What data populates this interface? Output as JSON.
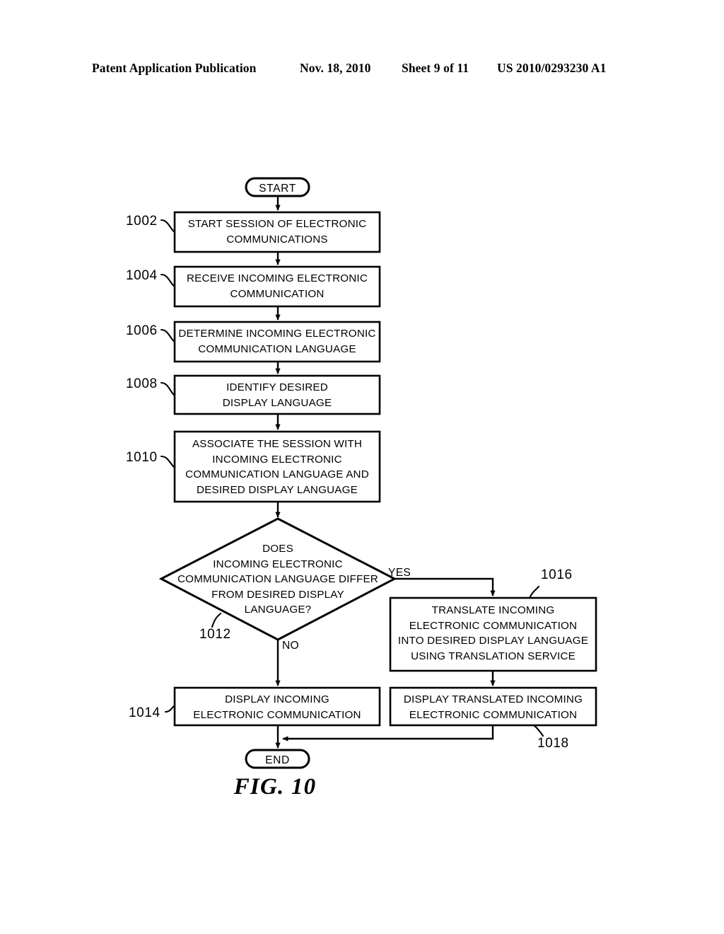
{
  "header": {
    "publication": "Patent Application Publication",
    "date": "Nov. 18, 2010",
    "sheet": "Sheet 9 of 11",
    "patent_number": "US 2010/0293230 A1"
  },
  "figure": {
    "caption": "FIG. 10",
    "ink_color": "#000000",
    "background_color": "#ffffff"
  },
  "flowchart": {
    "start": {
      "label": "START"
    },
    "end": {
      "label": "END"
    },
    "branch_yes": "YES",
    "branch_no": "NO",
    "nodes": [
      {
        "ref": "1002",
        "shape": "process",
        "text": "START SESSION OF ELECTRONIC\nCOMMUNICATIONS"
      },
      {
        "ref": "1004",
        "shape": "process",
        "text": "RECEIVE INCOMING ELECTRONIC\nCOMMUNICATION"
      },
      {
        "ref": "1006",
        "shape": "process",
        "text": "DETERMINE INCOMING ELECTRONIC\nCOMMUNICATION LANGUAGE"
      },
      {
        "ref": "1008",
        "shape": "process",
        "text": "IDENTIFY DESIRED\nDISPLAY LANGUAGE"
      },
      {
        "ref": "1010",
        "shape": "process",
        "text": "ASSOCIATE THE SESSION WITH\nINCOMING ELECTRONIC\nCOMMUNICATION LANGUAGE AND\nDESIRED DISPLAY LANGUAGE"
      },
      {
        "ref": "1012",
        "shape": "decision",
        "text": "DOES\nINCOMING ELECTRONIC\nCOMMUNICATION LANGUAGE DIFFER\nFROM DESIRED DISPLAY\nLANGUAGE?"
      },
      {
        "ref": "1014",
        "shape": "process",
        "text": "DISPLAY INCOMING\nELECTRONIC COMMUNICATION"
      },
      {
        "ref": "1016",
        "shape": "process",
        "text": "TRANSLATE INCOMING\nELECTRONIC COMMUNICATION\nINTO DESIRED DISPLAY LANGUAGE\nUSING TRANSLATION SERVICE"
      },
      {
        "ref": "1018",
        "shape": "process",
        "text": "DISPLAY TRANSLATED INCOMING\nELECTRONIC COMMUNICATION"
      }
    ]
  }
}
